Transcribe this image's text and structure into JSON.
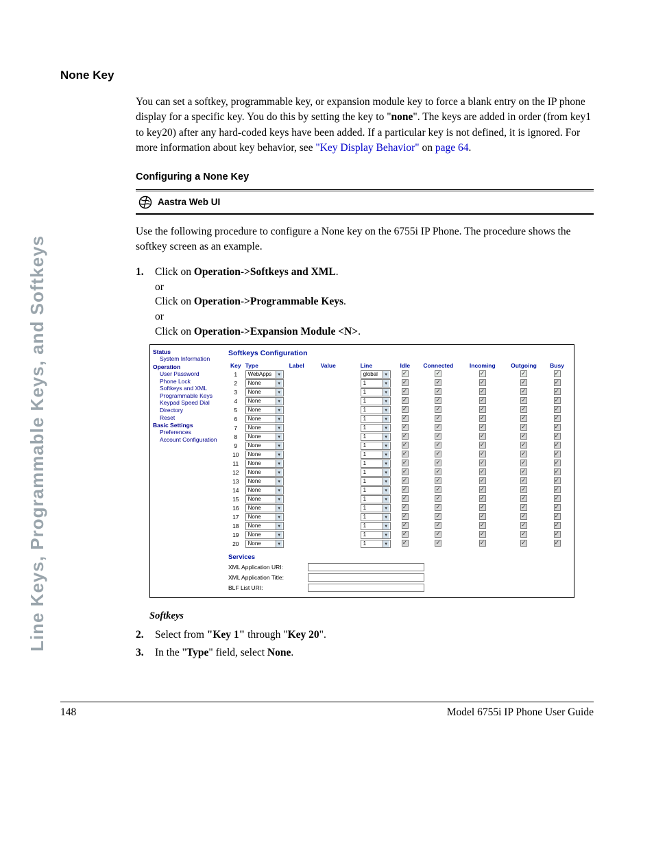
{
  "sideTab": "Line Keys, Programmable Keys, and Softkeys",
  "heading": "None Key",
  "intro_a": "You can set a softkey, programmable key, or expansion module key to force a blank entry on the IP phone display for a specific key. You do this by setting the key to \"",
  "intro_bold": "none",
  "intro_b": "\". The keys are added in order (from key1 to key20) after any hard-coded keys have been added. If a particular key is not defined, it is ignored. For more information about key behavior, see ",
  "intro_link1": "\"Key Display Behavior\"",
  "intro_c": " on ",
  "intro_link2": "page 64",
  "intro_d": ".",
  "subheading": "Configuring a None Key",
  "aastra": "Aastra Web UI",
  "procIntro": "Use the following procedure to configure a None key on the 6755i IP Phone. The procedure shows the softkey screen as an example.",
  "step1": {
    "num": "1.",
    "l1a": "Click on ",
    "l1b": "Operation->Softkeys and XML",
    "l1c": ".",
    "or": "or",
    "l2a": "Click on ",
    "l2b": "Operation->Programmable Keys",
    "l2c": ".",
    "l3a": "Click on ",
    "l3b": "Operation->Expansion Module <N>",
    "l3c": "."
  },
  "nav": {
    "status": "Status",
    "sysinfo": "System Information",
    "operation": "Operation",
    "items": [
      "User Password",
      "Phone Lock",
      "Softkeys and XML",
      "Programmable Keys",
      "Keypad Speed Dial",
      "Directory",
      "Reset"
    ],
    "basic": "Basic Settings",
    "bitems": [
      "Preferences",
      "Account Configuration"
    ]
  },
  "conf": {
    "title": "Softkeys Configuration",
    "cols": [
      "Key",
      "Type",
      "Label",
      "Value",
      "Line",
      "Idle",
      "Connected",
      "Incoming",
      "Outgoing",
      "Busy"
    ],
    "rows": [
      {
        "k": "1",
        "type": "WebApps",
        "line": "global",
        "active": true
      },
      {
        "k": "2",
        "type": "None",
        "line": "1",
        "active": false
      },
      {
        "k": "3",
        "type": "None",
        "line": "1",
        "active": false
      },
      {
        "k": "4",
        "type": "None",
        "line": "1",
        "active": false
      },
      {
        "k": "5",
        "type": "None",
        "line": "1",
        "active": false
      },
      {
        "k": "6",
        "type": "None",
        "line": "1",
        "active": false
      },
      {
        "k": "7",
        "type": "None",
        "line": "1",
        "active": false
      },
      {
        "k": "8",
        "type": "None",
        "line": "1",
        "active": false
      },
      {
        "k": "9",
        "type": "None",
        "line": "1",
        "active": false
      },
      {
        "k": "10",
        "type": "None",
        "line": "1",
        "active": false
      },
      {
        "k": "11",
        "type": "None",
        "line": "1",
        "active": false
      },
      {
        "k": "12",
        "type": "None",
        "line": "1",
        "active": false
      },
      {
        "k": "13",
        "type": "None",
        "line": "1",
        "active": false
      },
      {
        "k": "14",
        "type": "None",
        "line": "1",
        "active": false
      },
      {
        "k": "15",
        "type": "None",
        "line": "1",
        "active": false
      },
      {
        "k": "16",
        "type": "None",
        "line": "1",
        "active": false
      },
      {
        "k": "17",
        "type": "None",
        "line": "1",
        "active": false
      },
      {
        "k": "18",
        "type": "None",
        "line": "1",
        "active": false
      },
      {
        "k": "19",
        "type": "None",
        "line": "1",
        "active": false
      },
      {
        "k": "20",
        "type": "None",
        "line": "1",
        "active": false
      }
    ],
    "services": "Services",
    "svc": [
      "XML Application URI:",
      "XML Application Title:",
      "BLF List URI:"
    ]
  },
  "softkeysLabel": "Softkeys",
  "step2": {
    "num": "2.",
    "a": "Select from ",
    "b": "\"Key 1\"",
    "c": " through \"",
    "d": "Key 20",
    "e": "\"."
  },
  "step3": {
    "num": "3.",
    "a": "In the \"",
    "b": "Type",
    "c": "\" field, select ",
    "d": "None",
    "e": "."
  },
  "footer": {
    "page": "148",
    "title": "Model 6755i IP Phone User Guide"
  }
}
